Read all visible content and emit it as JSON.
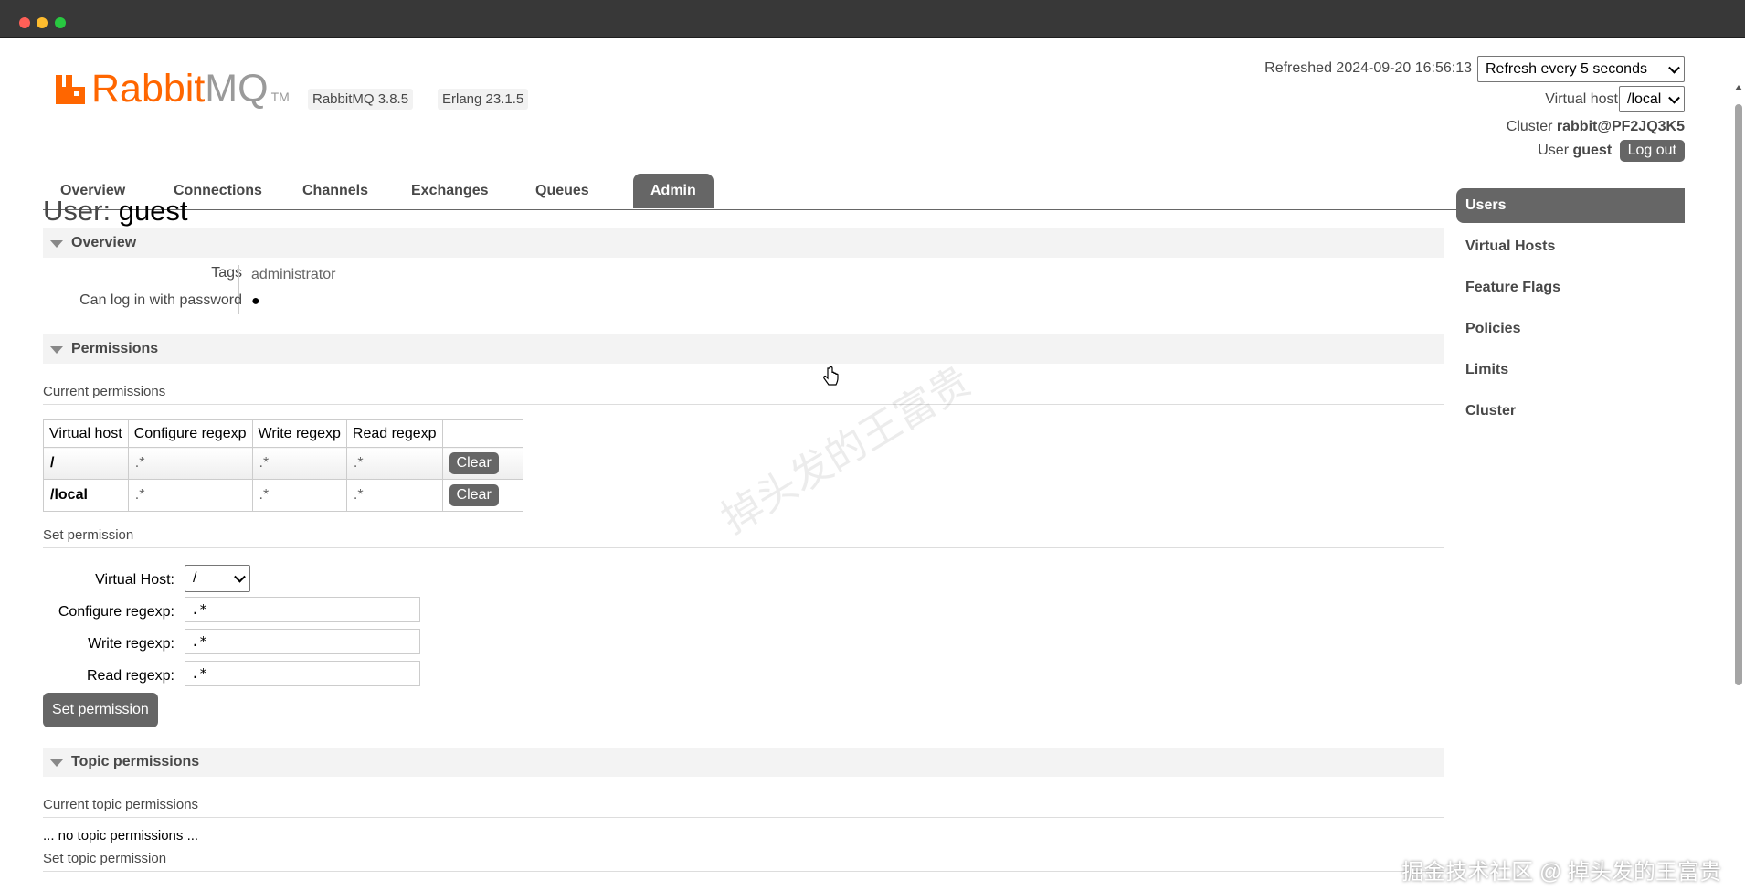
{
  "window": {
    "title": ""
  },
  "brand": {
    "name_primary": "Rabbit",
    "name_secondary": "MQ",
    "trademark": "TM",
    "accent_color": "#ff6600"
  },
  "versions": {
    "rabbitmq": "RabbitMQ 3.8.5",
    "erlang": "Erlang 23.1.5"
  },
  "status": {
    "refreshed": "Refreshed 2024-09-20 16:56:13",
    "refresh_option": "Refresh every 5 seconds",
    "vhost_label": "Virtual host",
    "vhost_value": "/local",
    "cluster_label": "Cluster",
    "cluster_value": "rabbit@PF2JQ3K5",
    "user_label": "User",
    "user_value": "guest",
    "logout_label": "Log out"
  },
  "nav": {
    "tabs": [
      {
        "label": "Overview",
        "active": false
      },
      {
        "label": "Connections",
        "active": false
      },
      {
        "label": "Channels",
        "active": false
      },
      {
        "label": "Exchanges",
        "active": false
      },
      {
        "label": "Queues",
        "active": false
      },
      {
        "label": "Admin",
        "active": true
      }
    ]
  },
  "sidebar": {
    "items": [
      {
        "label": "Users",
        "active": true
      },
      {
        "label": "Virtual Hosts",
        "active": false
      },
      {
        "label": "Feature Flags",
        "active": false
      },
      {
        "label": "Policies",
        "active": false
      },
      {
        "label": "Limits",
        "active": false
      },
      {
        "label": "Cluster",
        "active": false
      }
    ]
  },
  "page": {
    "title_prefix": "User:",
    "title_name": "guest",
    "overview": {
      "heading": "Overview",
      "tags_label": "Tags",
      "tags_value": "administrator",
      "password_label": "Can log in with password",
      "password_value": "●"
    },
    "permissions": {
      "heading": "Permissions",
      "current_heading": "Current permissions",
      "columns": [
        "Virtual host",
        "Configure regexp",
        "Write regexp",
        "Read regexp"
      ],
      "rows": [
        {
          "vhost": "/",
          "configure": ".*",
          "write": ".*",
          "read": ".*",
          "action": "Clear"
        },
        {
          "vhost": "/local",
          "configure": ".*",
          "write": ".*",
          "read": ".*",
          "action": "Clear"
        }
      ],
      "set_heading": "Set permission",
      "form": {
        "vhost_label": "Virtual Host:",
        "vhost_value": "/",
        "configure_label": "Configure regexp:",
        "configure_value": ".*",
        "write_label": "Write regexp:",
        "write_value": ".*",
        "read_label": "Read regexp:",
        "read_value": ".*",
        "submit_label": "Set permission"
      }
    },
    "topic": {
      "heading": "Topic permissions",
      "current_heading": "Current topic permissions",
      "empty_text": "... no topic permissions ...",
      "set_heading": "Set topic permission"
    }
  },
  "overlay": {
    "watermark": "掉头发的王富贵",
    "credit": "掘金技术社区 @ 掉头发的王富贵"
  }
}
